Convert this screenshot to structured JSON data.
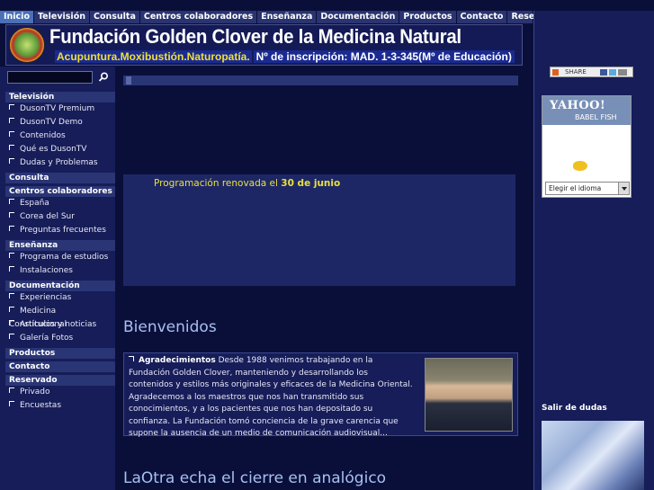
{
  "nav": {
    "tabs": [
      "Inicio",
      "Televisión",
      "Consulta",
      "Centros colaboradores",
      "Enseñanza",
      "Documentación",
      "Productos",
      "Contacto",
      "Reservado"
    ],
    "active_tab": "Inicio"
  },
  "banner": {
    "title": "Fundación Golden Clover de la Medicina Natural",
    "subtitle_disciplines": "Acupuntura.Moxibustión.Naturopatía.",
    "subtitle_registration": "Nº de inscripción:  MAD. 1-3-345(Mº de Educación)"
  },
  "search": {
    "value": ""
  },
  "sidebar": {
    "sections": [
      {
        "heading": "Televisión",
        "items": [
          "DusonTV Premium",
          "DusonTV Demo",
          "Contenidos",
          "Qué es DusonTV",
          "Dudas y Problemas"
        ]
      },
      {
        "heading": "Consulta",
        "items": []
      },
      {
        "heading": "Centros colaboradores",
        "items": [
          "España",
          "Corea del Sur",
          "Preguntas frecuentes"
        ]
      },
      {
        "heading": "Enseñanza",
        "items": [
          "Programa de estudios",
          "Instalaciones"
        ]
      },
      {
        "heading": "Documentación",
        "items": [
          "Experiencias",
          "Medicina Constitucional",
          "Artículos y noticias",
          "Galería Fotos"
        ]
      },
      {
        "heading": "Productos",
        "items": []
      },
      {
        "heading": "Contacto",
        "items": []
      },
      {
        "heading": "Reservado",
        "items": [
          "Privado",
          "Encuestas"
        ]
      }
    ]
  },
  "promo": {
    "text_prefix": "Programación renovada el ",
    "text_date": "30 de junio"
  },
  "welcome": {
    "heading": "Bienvenidos",
    "lead": "Agradecimientos",
    "body": " Desde 1988 venimos trabajando en la Fundación Golden Clover, manteniendo y desarrollando los contenidos y estilos más originales y eficaces de la Medicina Oriental. Agradecemos a los maestros que nos han transmitido sus conocimientos, y a los pacientes que nos han depositado su confianza. La Fundación tomó conciencia de la grave carencia que supone la ausencia de un medio de comunicación audiovisual..."
  },
  "second_heading": "LaOtra echa el cierre en analógico",
  "right": {
    "share_label": "SHARE",
    "babel_brand": "YAHOO!",
    "babel_label": "BABEL FISH",
    "babel_select": "Elegir el idioma",
    "faq_heading": "Salir de dudas"
  }
}
